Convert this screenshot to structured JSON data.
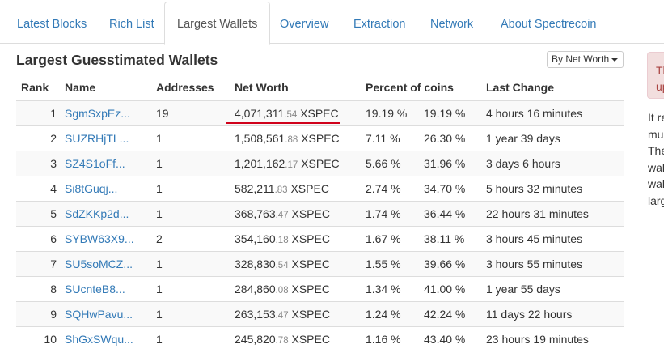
{
  "tabs": [
    "Latest Blocks",
    "Rich List",
    "Largest Wallets",
    "Overview",
    "Extraction",
    "Network",
    "About Spectrecoin"
  ],
  "active_tab": "Largest Wallets",
  "title": "Largest Guesstimated Wallets",
  "sort_button": "By Net Worth",
  "columns": {
    "rank": "Rank",
    "name": "Name",
    "addresses": "Addresses",
    "net_worth": "Net Worth",
    "percent": "Percent of coins",
    "last_change": "Last Change"
  },
  "rows": [
    {
      "rank": "1",
      "name": "SgmSxpEz...",
      "addresses": "19",
      "net_int": "4,071,311",
      "net_dec": ".54",
      "unit": " XSPEC",
      "pct": "19.19 %",
      "cum": "19.19 %",
      "change": "4 hours 16 minutes"
    },
    {
      "rank": "2",
      "name": "SUZRHjTL...",
      "addresses": "1",
      "net_int": "1,508,561",
      "net_dec": ".88",
      "unit": " XSPEC",
      "pct": "7.11 %",
      "cum": "26.30 %",
      "change": "1 year 39 days"
    },
    {
      "rank": "3",
      "name": "SZ4S1oFf...",
      "addresses": "1",
      "net_int": "1,201,162",
      "net_dec": ".17",
      "unit": " XSPEC",
      "pct": "5.66 %",
      "cum": "31.96 %",
      "change": "3 days 6 hours"
    },
    {
      "rank": "4",
      "name": "Si8tGuqj...",
      "addresses": "1",
      "net_int": "582,211",
      "net_dec": ".83",
      "unit": " XSPEC",
      "pct": "2.74 %",
      "cum": "34.70 %",
      "change": "5 hours 32 minutes"
    },
    {
      "rank": "5",
      "name": "SdZKKp2d...",
      "addresses": "1",
      "net_int": "368,763",
      "net_dec": ".47",
      "unit": " XSPEC",
      "pct": "1.74 %",
      "cum": "36.44 %",
      "change": "22 hours 31 minutes"
    },
    {
      "rank": "6",
      "name": "SYBW63X9...",
      "addresses": "2",
      "net_int": "354,160",
      "net_dec": ".18",
      "unit": " XSPEC",
      "pct": "1.67 %",
      "cum": "38.11 %",
      "change": "3 hours 45 minutes"
    },
    {
      "rank": "7",
      "name": "SU5soMCZ...",
      "addresses": "1",
      "net_int": "328,830",
      "net_dec": ".54",
      "unit": " XSPEC",
      "pct": "1.55 %",
      "cum": "39.66 %",
      "change": "3 hours 55 minutes"
    },
    {
      "rank": "8",
      "name": "SUcnteB8...",
      "addresses": "1",
      "net_int": "284,860",
      "net_dec": ".08",
      "unit": " XSPEC",
      "pct": "1.34 %",
      "cum": "41.00 %",
      "change": "1 year 55 days"
    },
    {
      "rank": "9",
      "name": "SQHwPavu...",
      "addresses": "1",
      "net_int": "263,153",
      "net_dec": ".47",
      "unit": " XSPEC",
      "pct": "1.24 %",
      "cum": "42.24 %",
      "change": "11 days 22 hours"
    },
    {
      "rank": "10",
      "name": "ShGxSWqu...",
      "addresses": "1",
      "net_int": "245,820",
      "net_dec": ".78",
      "unit": " XSPEC",
      "pct": "1.16 %",
      "cum": "43.40 %",
      "change": "23 hours 19 minutes"
    }
  ],
  "alert_text": [
    "Th",
    "up"
  ],
  "side_text": [
    "It re",
    "mu",
    "The",
    "wal",
    "wal",
    "larg"
  ],
  "colors": {
    "link": "#337ab7",
    "highlight_underline": "#d0021b",
    "alert_bg": "#f2dede"
  }
}
